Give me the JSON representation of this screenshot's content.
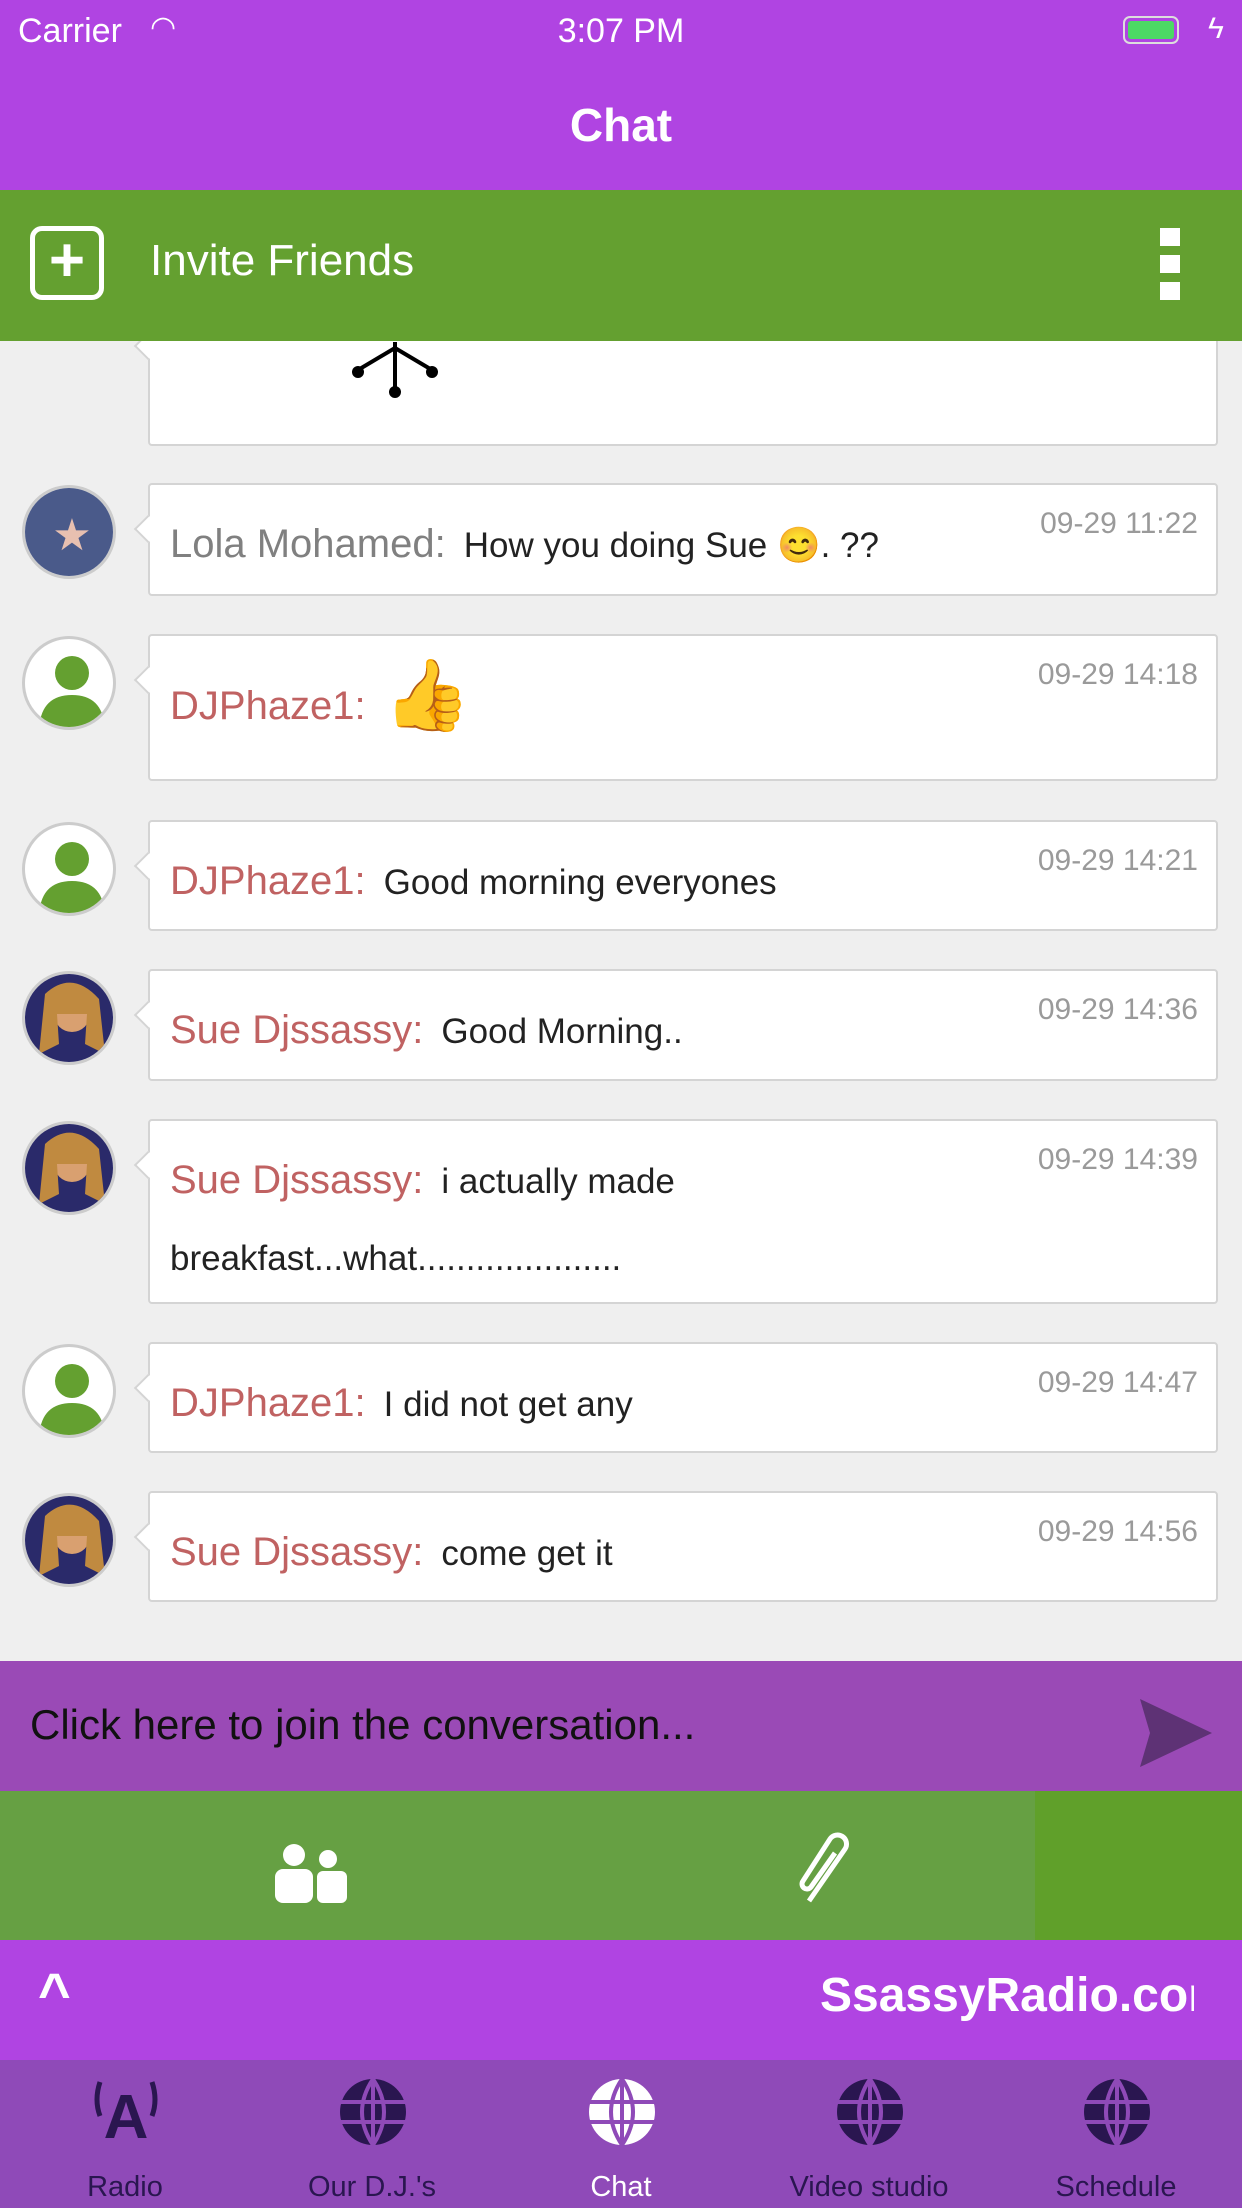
{
  "status_bar": {
    "carrier": "Carrier",
    "time": "3:07 PM"
  },
  "nav": {
    "title": "Chat"
  },
  "invite": {
    "label": "Invite Friends"
  },
  "messages": [
    {
      "author": "Lola Mohamed:",
      "text": "How you doing Sue 😊. ??",
      "time": "09-29 11:22",
      "avatar": "star"
    },
    {
      "author": "DJPhaze1:",
      "text": "👍",
      "time": "09-29 14:18",
      "avatar": "default"
    },
    {
      "author": "DJPhaze1:",
      "text": "Good morning everyones",
      "time": "09-29 14:21",
      "avatar": "default"
    },
    {
      "author": "Sue Djssassy:",
      "text": "Good Morning..",
      "time": "09-29 14:36",
      "avatar": "photo"
    },
    {
      "author": "Sue Djssassy:",
      "text": "i actually made breakfast...what.....................",
      "time": "09-29 14:39",
      "avatar": "photo"
    },
    {
      "author": "DJPhaze1:",
      "text": "I did not get any",
      "time": "09-29 14:47",
      "avatar": "default"
    },
    {
      "author": "Sue Djssassy:",
      "text": "come get it",
      "time": "09-29 14:56",
      "avatar": "photo"
    }
  ],
  "input": {
    "placeholder": "Click here to join the conversation..."
  },
  "player": {
    "station": "SsassyRadio.com"
  },
  "tabs": [
    {
      "label": "Radio"
    },
    {
      "label": "Our D.J.'s"
    },
    {
      "label": "Chat",
      "active": true
    },
    {
      "label": "Video studio"
    },
    {
      "label": "Schedule"
    }
  ],
  "colors": {
    "purple": "#b044e2",
    "green": "#64a030",
    "name": "#c06262"
  }
}
